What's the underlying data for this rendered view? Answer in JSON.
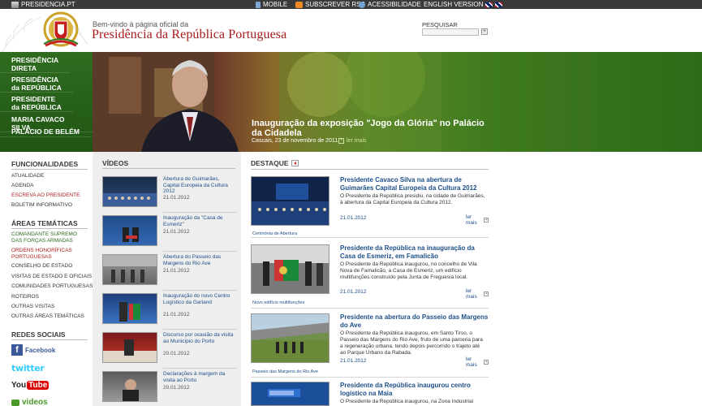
{
  "topbar": {
    "site": "PRESIDENCIA.PT",
    "mobile": "MOBILE",
    "rss": "SUBSCREVER RSS",
    "accessibility": "ACESSIBILIDADE",
    "english": "ENGLISH VERSION"
  },
  "header": {
    "welcome": "Bem-vindo à página oficial da",
    "brand": "Presidência da República Portuguesa",
    "search_label": "PESQUISAR",
    "search_placeholder": "",
    "search_button": "+"
  },
  "nav": [
    {
      "line1": "PRESIDÊNCIA",
      "line2": "DIRETA"
    },
    {
      "line1": "PRESIDÊNCIA",
      "line2": "da REPÚBLICA"
    },
    {
      "line1": "PRESIDENTE",
      "line2": "da REPÚBLICA"
    },
    {
      "line1": "MARIA CAVACO SILVA",
      "line2": ""
    },
    {
      "line1": "PALÁCIO DE BELÉM",
      "line2": ""
    }
  ],
  "hero": {
    "title": "Inauguração da exposição \"Jogo da Glória\" no Palácio da Cidadela",
    "subtitle": "Cascais, 23 de novembro de 2011",
    "more": "ler mais"
  },
  "sidebar": {
    "funcionalidades_title": "FUNCIONALIDADES",
    "funcionalidades": [
      "ATUALIDADE",
      "AGENDA",
      "ESCREVA AO PRESIDENTE",
      "BOLETIM INFORMATIVO"
    ],
    "areas_title": "ÁREAS TEMÁTICAS",
    "areas": [
      {
        "line1": "COMANDANTE SUPREMO",
        "line2": "DAS FORÇAS ARMADAS"
      },
      {
        "line1": "ORDENS HONORÍFICAS",
        "line2": "PORTUGUESAS"
      },
      {
        "line1": "CONSELHO DE ESTADO",
        "line2": ""
      },
      {
        "line1": "VISITAS DE ESTADO E OFICIAIS",
        "line2": ""
      },
      {
        "line1": "COMUNIDADES PORTUGUESAS",
        "line2": ""
      },
      {
        "line1": "ROTEIROS",
        "line2": ""
      },
      {
        "line1": "OUTRAS VISITAS",
        "line2": ""
      },
      {
        "line1": "OUTRAS ÁREAS TEMÁTICAS",
        "line2": ""
      }
    ],
    "social_title": "REDES SOCIAIS",
    "facebook": "Facebook",
    "twitter": "twitter",
    "youtube_you": "You",
    "youtube_tube": "Tube",
    "videos": "videos"
  },
  "videos": {
    "title": "VÍDEOS",
    "items": [
      {
        "title": "Abertura de Guimarães, Capital Europeia da Cultura 2012",
        "date": "21.01.2012"
      },
      {
        "title": "Inauguração da \"Casa de Esmeriz\"",
        "date": "21.01.2012"
      },
      {
        "title": "Abertura do Passeio das Margens do Rio Ave",
        "date": "21.01.2012"
      },
      {
        "title": "Inauguração do novo Centro Logístico da Garland",
        "date": "21.01.2012"
      },
      {
        "title": "Discurso por ocasião da visita ao Município do Porto",
        "date": "20.01.2012"
      },
      {
        "title": "Declarações à margem da visita ao Porto",
        "date": "20.01.2012"
      }
    ]
  },
  "destaque": {
    "title": "DESTAQUE",
    "items": [
      {
        "title": "Presidente Cavaco Silva na abertura de Guimarães Capital Europeia da Cultura 2012",
        "text": "O Presidente da República presidiu, na cidade de Guimarães, à abertura da Capital Europeia da Cultura 2012.",
        "date": "21.01.2012",
        "more": "ler mais",
        "caption": "Cerimónia de Abertura"
      },
      {
        "title": "Presidente da República na inauguração da Casa de Esmeriz, em Famalicão",
        "text": "O Presidente da República inaugurou, no concelho de Vila Nova de Famalicão, a Casa de Esmeriz, um edifício multifunções construído pela Junta de Freguesia local.",
        "date": "21.01.2012",
        "more": "ler mais",
        "caption": "Novo edifício multifunções"
      },
      {
        "title": "Presidente na abertura do Passeio das Margens do Ave",
        "text": "O Presidente da República inaugurou, em Santo Tirso, o Passeio das Margens do Rio Ave, fruto de uma parceria para a regeneração urbana, tendo depois percorrido o trajeto até ao Parque Urbano da Rabada.",
        "date": "21.01.2012",
        "more": "ler mais",
        "caption": "Passeio das Margens do Rio Ave"
      },
      {
        "title": "Presidente da República inaugurou centro logístico na Maia",
        "text": "O Presidente da República inaugurou, na Zona Industrial",
        "date": "",
        "more": "",
        "caption": ""
      }
    ]
  },
  "colors": {
    "brand_red": "#a81a1a",
    "nav_green": "#2f6c1f",
    "link_blue": "#1d4e89",
    "video_bg": "#eeeeee"
  }
}
